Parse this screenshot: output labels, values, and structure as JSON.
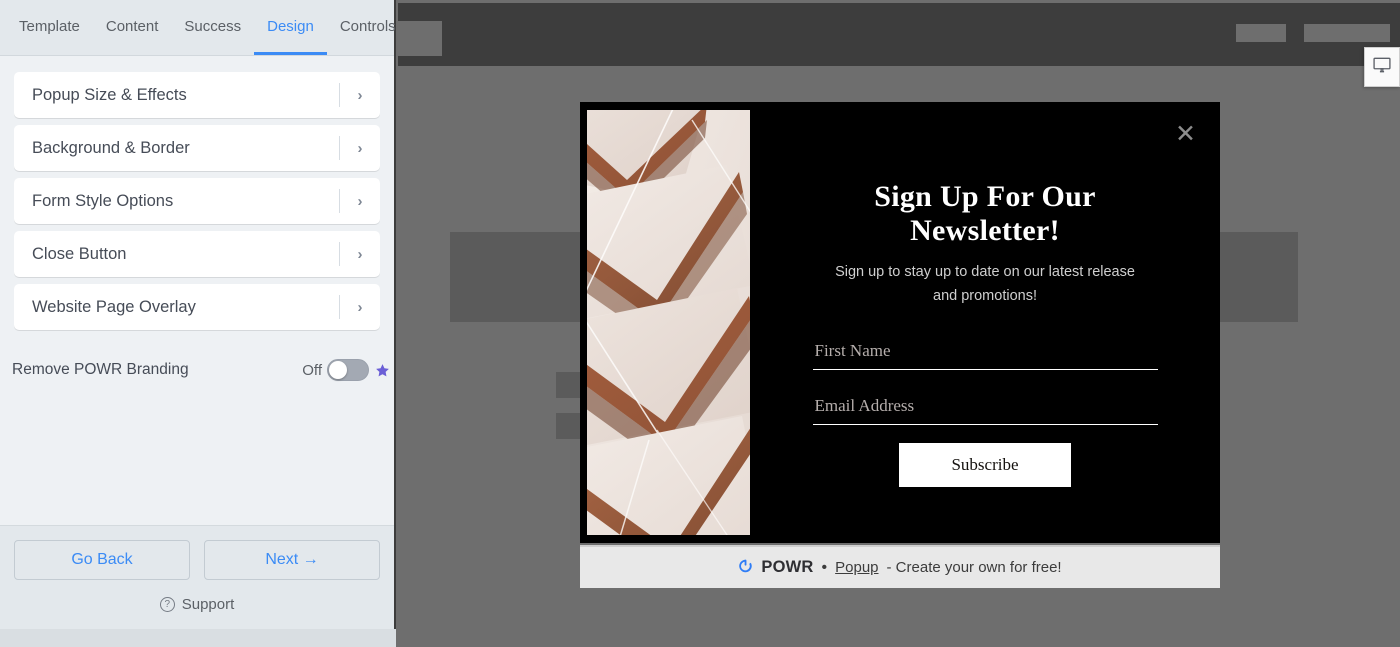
{
  "editor": {
    "tabs": [
      {
        "label": "Template",
        "active": false
      },
      {
        "label": "Content",
        "active": false
      },
      {
        "label": "Success",
        "active": false
      },
      {
        "label": "Design",
        "active": true
      },
      {
        "label": "Controls",
        "active": false
      }
    ],
    "accordion": [
      {
        "label": "Popup Size & Effects",
        "chevron": "›"
      },
      {
        "label": "Background & Border",
        "chevron": "›"
      },
      {
        "label": "Form Style Options",
        "chevron": "›"
      },
      {
        "label": "Close Button",
        "chevron": "›"
      },
      {
        "label": "Website Page Overlay",
        "chevron": "›"
      }
    ],
    "branding": {
      "label": "Remove POWR Branding",
      "toggle_state": "Off",
      "toggle_on": false,
      "star_color": "#6b5fd6"
    },
    "footer": {
      "back_label": "Go Back",
      "next_label": "Next →",
      "support_label": "Support",
      "help_glyph": "?"
    },
    "accent_color": "#3b8bf5"
  },
  "preview": {
    "device_icon": "desktop-monitor-icon"
  },
  "popup": {
    "close_glyph": "✕",
    "title": "Sign Up For Our Newsletter!",
    "subtitle": "Sign up to stay up to date on our latest release and promotions!",
    "fields": [
      {
        "name": "first-name",
        "placeholder": "First Name",
        "value": ""
      },
      {
        "name": "email-address",
        "placeholder": "Email Address",
        "value": ""
      }
    ],
    "submit_label": "Subscribe",
    "background_color": "#000000",
    "submit_bg": "#ffffff"
  },
  "powr_bar": {
    "brand": "POWR",
    "separator": "•",
    "link_label": "Popup",
    "tail_text": "- Create your own for free!"
  }
}
